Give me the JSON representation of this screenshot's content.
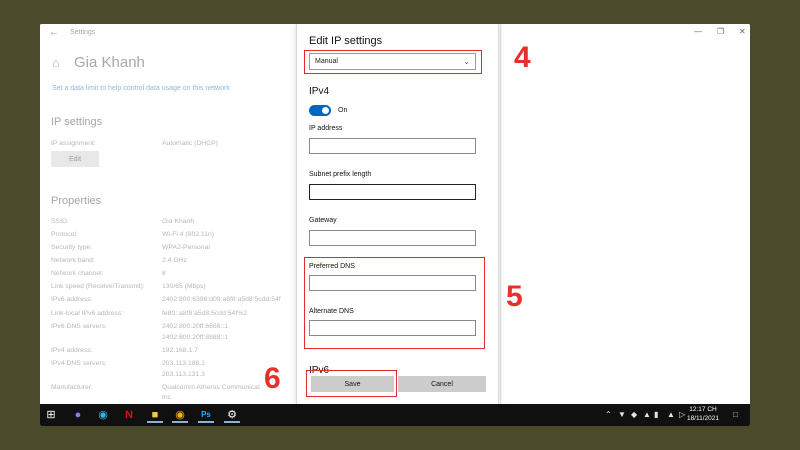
{
  "settings": {
    "window_title": "Settings",
    "page_title": "Gia Khanh",
    "data_limit_link": "Set a data limit to help control data usage on this network",
    "ip_settings_title": "IP settings",
    "ip_assignment_label": "IP assignment:",
    "ip_assignment_value": "Automatic (DHCP)",
    "edit_label": "Edit",
    "properties_title": "Properties",
    "properties": [
      {
        "k": "SSID:",
        "v": "Gia Khanh"
      },
      {
        "k": "Protocol:",
        "v": "Wi-Fi 4 (802.11n)"
      },
      {
        "k": "Security type:",
        "v": "WPA2-Personal"
      },
      {
        "k": "Network band:",
        "v": "2.4 GHz"
      },
      {
        "k": "Network channel:",
        "v": "8"
      },
      {
        "k": "Link speed (Receive/Transmit):",
        "v": "130/65 (Mbps)"
      },
      {
        "k": "IPv6 address:",
        "v": "2402:800:6398:d09:a8f8:a5d8:5cdd:54f"
      },
      {
        "k": "Link-local IPv6 address:",
        "v": "fe80::a8f8:a5d8:5cdd:54f%2"
      },
      {
        "k": "IPv6 DNS servers:",
        "v": "2402:800:20ff:6666::1"
      },
      {
        "k": "",
        "v": "2402:800:20ff:8888::1"
      },
      {
        "k": "IPv4 address:",
        "v": "192.168.1.7"
      },
      {
        "k": "IPv4 DNS servers:",
        "v": "203.113.188.1"
      },
      {
        "k": "",
        "v": "203.113.131.3"
      },
      {
        "k": "Manufacturer:",
        "v": "Qualcomm Atheros Communicat"
      },
      {
        "k": "",
        "v": "Inc."
      }
    ]
  },
  "dialog": {
    "title": "Edit IP settings",
    "mode_selected": "Manual",
    "ipv4_title": "IPv4",
    "toggle_label": "On",
    "ip_address_label": "IP address",
    "subnet_label": "Subnet prefix length",
    "gateway_label": "Gateway",
    "preferred_dns_label": "Preferred DNS",
    "alternate_dns_label": "Alternate DNS",
    "ipv6_title": "IPv6",
    "save_label": "Save",
    "cancel_label": "Cancel"
  },
  "annotations": {
    "step4": "4",
    "step5": "5",
    "step6": "6",
    "color": "#e32b2b"
  },
  "taskbar": {
    "icons": [
      "windows-start",
      "teams",
      "edge",
      "netflix",
      "file-explorer",
      "chrome",
      "photoshop",
      "settings"
    ],
    "clock_time": "12:17 CH",
    "clock_date": "18/11/2021"
  },
  "colors": {
    "accent": "#0067c0",
    "taskbar": "#101010"
  }
}
